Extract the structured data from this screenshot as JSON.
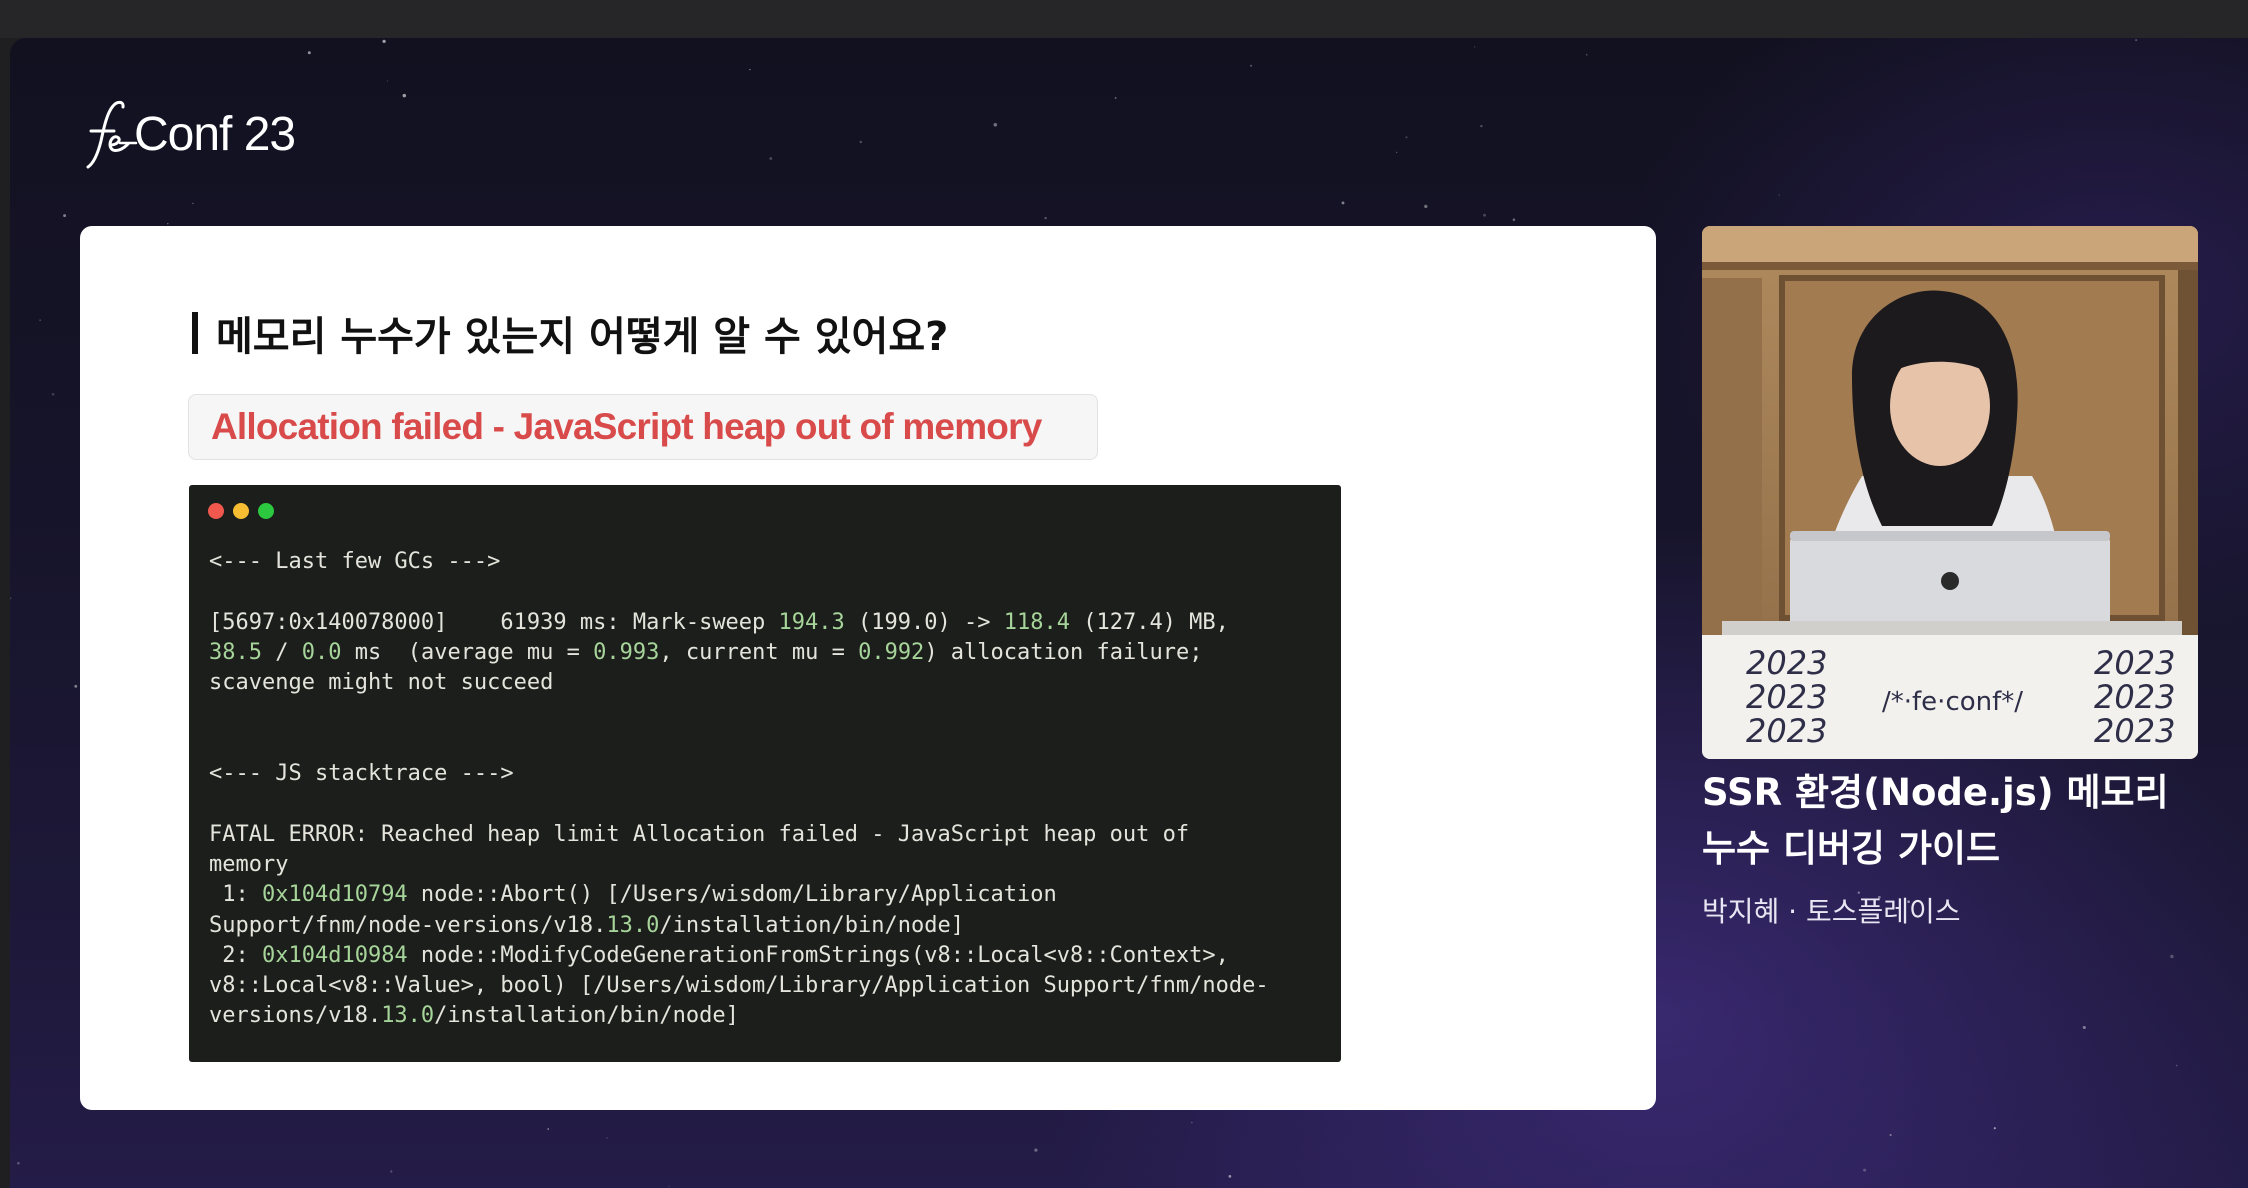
{
  "conference": {
    "logo_text": "Conf 23"
  },
  "slide": {
    "title": "메모리 누수가 있는지 어떻게 알 수 있어요?",
    "error_banner": "Allocation failed - JavaScript heap out of memory",
    "terminal_lines": [
      [
        {
          "t": "<--- Last few GCs --->"
        }
      ],
      [],
      [
        {
          "t": "[5697:0x140078000]    61939 ms: Mark-sweep "
        },
        {
          "t": "194.3",
          "c": "g"
        },
        {
          "t": " (199.0) -> "
        },
        {
          "t": "118.4",
          "c": "g"
        },
        {
          "t": " (127.4) MB,"
        }
      ],
      [
        {
          "t": "38.5",
          "c": "g"
        },
        {
          "t": " / "
        },
        {
          "t": "0.0",
          "c": "g"
        },
        {
          "t": " ms  (average mu = "
        },
        {
          "t": "0.993",
          "c": "g"
        },
        {
          "t": ", current mu = "
        },
        {
          "t": "0.992",
          "c": "g"
        },
        {
          "t": ") allocation failure;"
        }
      ],
      [
        {
          "t": "scavenge might not succeed"
        }
      ],
      [],
      [],
      [
        {
          "t": "<--- JS stacktrace --->"
        }
      ],
      [],
      [
        {
          "t": "FATAL ERROR: Reached heap limit Allocation failed - JavaScript heap out of"
        }
      ],
      [
        {
          "t": "memory"
        }
      ],
      [
        {
          "t": " 1: "
        },
        {
          "t": "0x104d10794",
          "c": "g"
        },
        {
          "t": " node::Abort() [/Users/wisdom/Library/Application"
        }
      ],
      [
        {
          "t": "Support/fnm/node-versions/v18."
        },
        {
          "t": "13.0",
          "c": "g"
        },
        {
          "t": "/installation/bin/node]"
        }
      ],
      [
        {
          "t": " 2: "
        },
        {
          "t": "0x104d10984",
          "c": "g"
        },
        {
          "t": " node::ModifyCodeGenerationFromStrings(v8::Local<v8::Context>,"
        }
      ],
      [
        {
          "t": "v8::Local<v8::Value>, bool) [/Users/wisdom/Library/Application Support/fnm/node-"
        }
      ],
      [
        {
          "t": "versions/v18."
        },
        {
          "t": "13.0",
          "c": "g"
        },
        {
          "t": "/installation/bin/node]"
        }
      ]
    ]
  },
  "speaker_video": {
    "podium_year": "2023",
    "podium_logo": "/*·fe·conf*/"
  },
  "talk": {
    "title_line1": "SSR 환경(Node.js) 메모리",
    "title_line2": "누수 디버깅 가이드",
    "speaker": "박지혜 · 토스플레이스"
  },
  "colors": {
    "error_red": "#d94b4b",
    "terminal_bg": "#1b1e1a",
    "terminal_text": "#e4e4dc",
    "terminal_number": "#a6d49a"
  }
}
